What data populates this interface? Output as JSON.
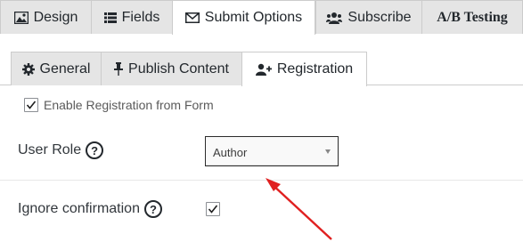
{
  "top_tabs": [
    {
      "label": "Design",
      "icon": "image-icon"
    },
    {
      "label": "Fields",
      "icon": "list-icon"
    },
    {
      "label": "Submit Options",
      "icon": "envelope-icon",
      "active": true
    },
    {
      "label": "Subscribe",
      "icon": "users-icon"
    },
    {
      "label": "A/B Testing",
      "icon": ""
    }
  ],
  "sub_tabs": [
    {
      "label": "General",
      "icon": "gear-icon"
    },
    {
      "label": "Publish Content",
      "icon": "pin-icon"
    },
    {
      "label": "Registration",
      "icon": "user-plus-icon",
      "active": true
    }
  ],
  "registration": {
    "enable_label": "Enable Registration from Form",
    "enable_checked": true,
    "user_role_label": "User Role",
    "user_role_value": "Author",
    "ignore_label": "Ignore confirmation",
    "ignore_checked": true,
    "help_glyph": "?"
  },
  "colors": {
    "annotation_arrow": "#e02020",
    "tab_inactive": "#e5e5e5",
    "tab_active": "#ffffff"
  }
}
